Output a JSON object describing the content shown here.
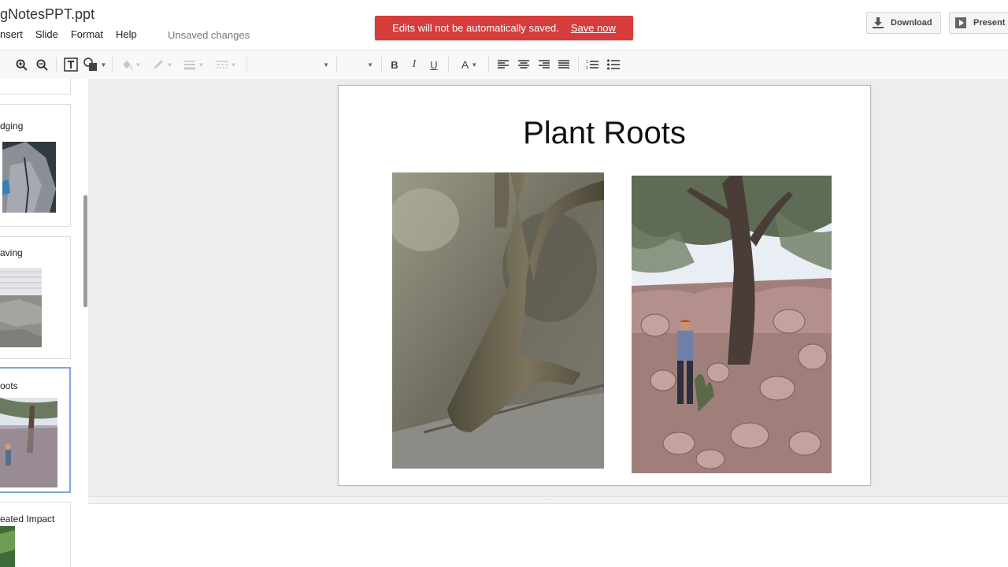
{
  "header": {
    "doc_title": "gNotesPPT.ppt",
    "menus": [
      "nsert",
      "Slide",
      "Format",
      "Help"
    ],
    "unsaved": "Unsaved changes",
    "banner_text": "Edits will not be automatically saved.",
    "banner_action": "Save now",
    "download_label": "Download",
    "present_label": "Present"
  },
  "toolbar": {
    "bold": "B",
    "italic": "I",
    "underline": "U",
    "text_color": "A"
  },
  "filmstrip": {
    "labels": [
      "dging",
      "aving",
      "oots",
      "eated Impact"
    ]
  },
  "slide": {
    "title": "Plant Roots"
  },
  "colors": {
    "banner": "#d63c3c",
    "selected_thumb": "#7fa4e0",
    "canvas_bg": "#ededed"
  }
}
